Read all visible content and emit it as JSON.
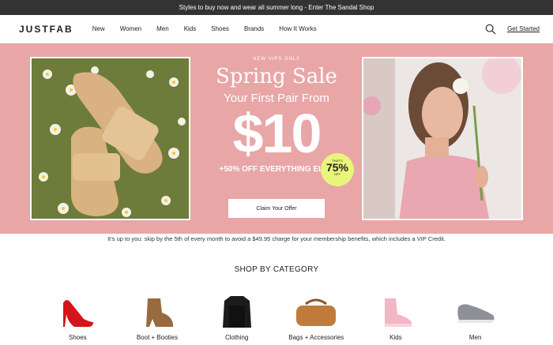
{
  "banner": {
    "text": "Styles to buy now and wear all summer long - Enter The Sandal Shop"
  },
  "header": {
    "logo": "JUSTFAB",
    "menu": [
      "New",
      "Women",
      "Men",
      "Kids",
      "Shoes",
      "Brands",
      "How It Works"
    ],
    "get_started": "Get Started"
  },
  "hero": {
    "vips": "NEW VIPS ONLY",
    "title": "Spring Sale",
    "subtitle": "Your First Pair From",
    "price": "$10",
    "badge_top": "THAT'S",
    "badge_value": "75%",
    "badge_bottom": "OFF",
    "extra": "+50% OFF EVERYTHING ELSE",
    "cta": "Claim Your Offer"
  },
  "notice": "It’s up to you: skip by the 5th of every month to avoid a $49.95 charge for your membership benefits, which includes a VIP Credit.",
  "shop": {
    "heading": "SHOP BY CATEGORY",
    "categories": [
      "Shoes",
      "Boot + Booties",
      "Clothing",
      "Bags + Accessories",
      "Kids",
      "Men"
    ]
  },
  "colors": {
    "hero_bg": "#e9a6a6",
    "badge": "#e9f57a",
    "topbar": "#333333"
  }
}
